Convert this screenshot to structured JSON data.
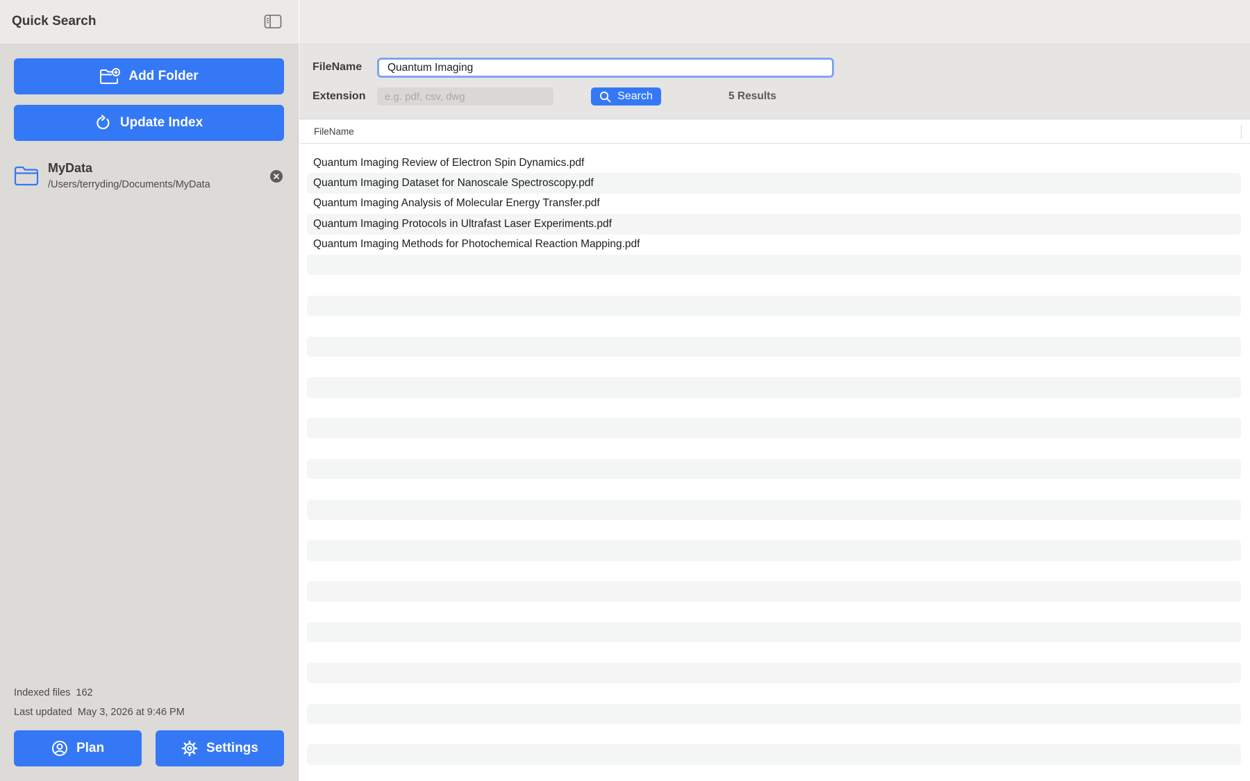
{
  "app": {
    "title": "Quick Search"
  },
  "sidebar": {
    "add_folder_label": "Add Folder",
    "update_index_label": "Update Index",
    "folders": [
      {
        "name": "MyData",
        "path": "/Users/terryding/Documents/MyData"
      }
    ],
    "stats": {
      "indexed_label": "Indexed files",
      "indexed_value": "162",
      "updated_label": "Last updated",
      "updated_value": "May 3, 2026 at 9:46 PM"
    },
    "plan_label": "Plan",
    "settings_label": "Settings"
  },
  "search": {
    "filename_label": "FileName",
    "filename_value": "Quantum Imaging",
    "extension_label": "Extension",
    "extension_placeholder": "e.g. pdf, csv, dwg",
    "extension_value": "",
    "search_button_label": "Search",
    "result_count": "5 Results"
  },
  "table": {
    "column_filename": "FileName",
    "rows": [
      "Quantum Imaging Review of Electron Spin Dynamics.pdf",
      "Quantum Imaging Dataset for Nanoscale Spectroscopy.pdf",
      "Quantum Imaging Analysis of Molecular Energy Transfer.pdf",
      "Quantum Imaging Protocols in Ultrafast Laser Experiments.pdf",
      "Quantum Imaging Methods for Photochemical Reaction Mapping.pdf"
    ]
  },
  "colors": {
    "accent": "#3478f6",
    "sidebar_bg": "#dddbd7",
    "focus_ring": "#7fa6ef"
  },
  "icons": {
    "sidebar_toggle": "sidebar-toggle-icon",
    "add_folder": "folder-badge-plus-icon",
    "update_index": "refresh-icon",
    "folder": "folder-icon",
    "remove": "xmark-circle-icon",
    "plan": "person-circle-icon",
    "settings": "gear-icon",
    "search": "magnifyingglass-icon"
  }
}
